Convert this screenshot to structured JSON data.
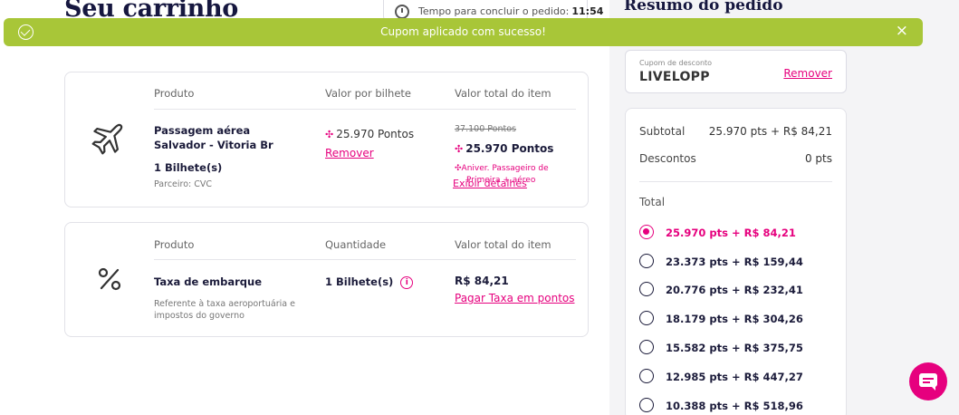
{
  "page": {
    "title": "Seu carrinho"
  },
  "timer": {
    "label": "Tempo para concluir o pedido:",
    "value": "11:54"
  },
  "toast": {
    "message": "Cupom aplicado com sucesso!",
    "close": "×",
    "color": "#a8c638"
  },
  "flight_item": {
    "headers": [
      "Produto",
      "Valor por bilhete",
      "Valor total do item"
    ],
    "icon": "airplane-icon",
    "product_line1": "Passagem aérea",
    "product_line2": "Salvador - Vitoria Br",
    "quantity": "1 Bilhete(s)",
    "partner": "Parceiro: CVC",
    "unit_value": "25.970 Pontos",
    "remove": "Remover",
    "old_total": "37.100 Pontos",
    "total": "25.970 Pontos",
    "promo": "Aniver. Passageiro de",
    "promo_line2": "Primeira + aéreo",
    "details": "Exibir detalhes"
  },
  "tax_item": {
    "headers": [
      "Produto",
      "Quantidade",
      "Valor total do item"
    ],
    "icon": "percent-icon",
    "product": "Taxa de embarque",
    "description_line1": "Referente à taxa aeroportuária e",
    "description_line2": "impostos do governo",
    "quantity": "1 Bilhete(s)",
    "total": "R$ 84,21",
    "pay_points": "Pagar Taxa em pontos"
  },
  "summary": {
    "title": "Resumo do pedido",
    "coupon_label": "Cupom de desconto",
    "coupon_value": "LIVELOPP",
    "coupon_remove": "Remover",
    "subtotal_label": "Subtotal",
    "subtotal_value": "25.970 pts + R$ 84,21",
    "discount_label": "Descontos",
    "discount_value": "0 pts",
    "total_label": "Total",
    "options": [
      {
        "label": "25.970 pts + R$ 84,21",
        "selected": true
      },
      {
        "label": "23.373 pts + R$ 159,44",
        "selected": false
      },
      {
        "label": "20.776 pts + R$ 232,41",
        "selected": false
      },
      {
        "label": "18.179 pts + R$ 304,26",
        "selected": false
      },
      {
        "label": "15.582 pts + R$ 375,75",
        "selected": false
      },
      {
        "label": "12.985 pts + R$ 447,27",
        "selected": false
      },
      {
        "label": "10.388 pts + R$ 518,96",
        "selected": false
      }
    ]
  },
  "colors": {
    "accent": "#e6007e",
    "navy": "#16173f",
    "success": "#a8c638"
  },
  "chat": {
    "icon": "chat-icon"
  }
}
